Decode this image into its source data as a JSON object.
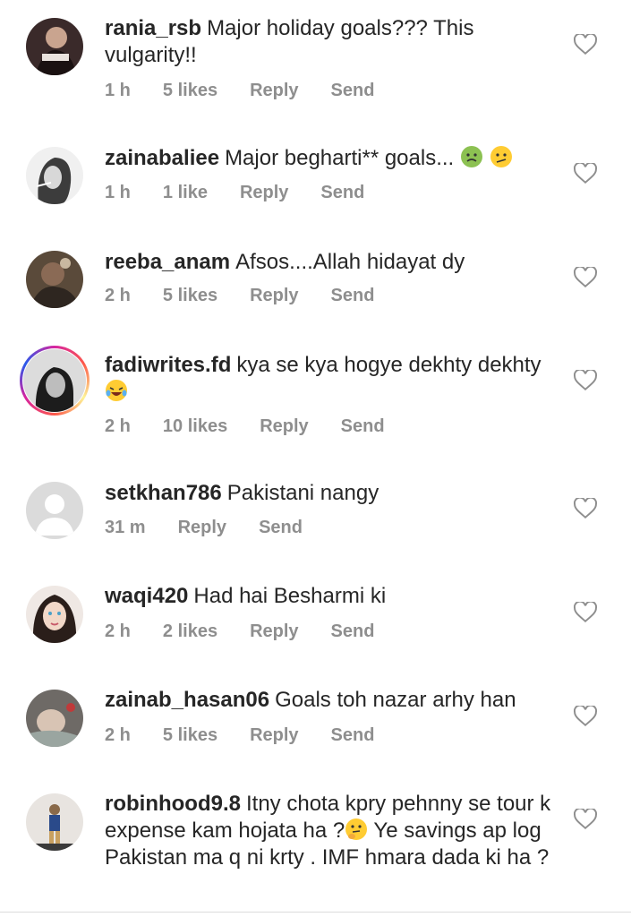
{
  "comments": [
    {
      "username": "rania_rsb",
      "text": "Major holiday goals??? This vulgarity!!",
      "time": "1 h",
      "likes": "5 likes",
      "reply": "Reply",
      "send": "Send"
    },
    {
      "username": "zainabaliee",
      "text": "Major begharti** goals...",
      "time": "1 h",
      "likes": "1 like",
      "reply": "Reply",
      "send": "Send"
    },
    {
      "username": "reeba_anam",
      "text": "Afsos....Allah hidayat dy",
      "time": "2 h",
      "likes": "5 likes",
      "reply": "Reply",
      "send": "Send"
    },
    {
      "username": "fadiwrites.fd",
      "text": "kya se kya hogye dekhty dekhty",
      "time": "2 h",
      "likes": "10 likes",
      "reply": "Reply",
      "send": "Send"
    },
    {
      "username": "setkhan786",
      "text": "Pakistani nangy",
      "time": "31 m",
      "reply": "Reply",
      "send": "Send"
    },
    {
      "username": "waqi420",
      "text": "Had hai Besharmi ki",
      "time": "2 h",
      "likes": "2 likes",
      "reply": "Reply",
      "send": "Send"
    },
    {
      "username": "zainab_hasan06",
      "text": "Goals toh nazar arhy han",
      "time": "2 h",
      "likes": "5 likes",
      "reply": "Reply",
      "send": "Send"
    },
    {
      "username": "robinhood9.8",
      "text": "Itny chota kpry pehnny se tour k expense kam hojata ha ?",
      "text2": "Ye savings ap log Pakistan ma q ni krty . IMF hmara dada ki ha ?"
    }
  ],
  "icons": {
    "like": "heart-outline-icon",
    "default_avatar": "default-avatar-icon"
  },
  "colors": {
    "meta": "#8e8e8e",
    "text": "#262626"
  }
}
